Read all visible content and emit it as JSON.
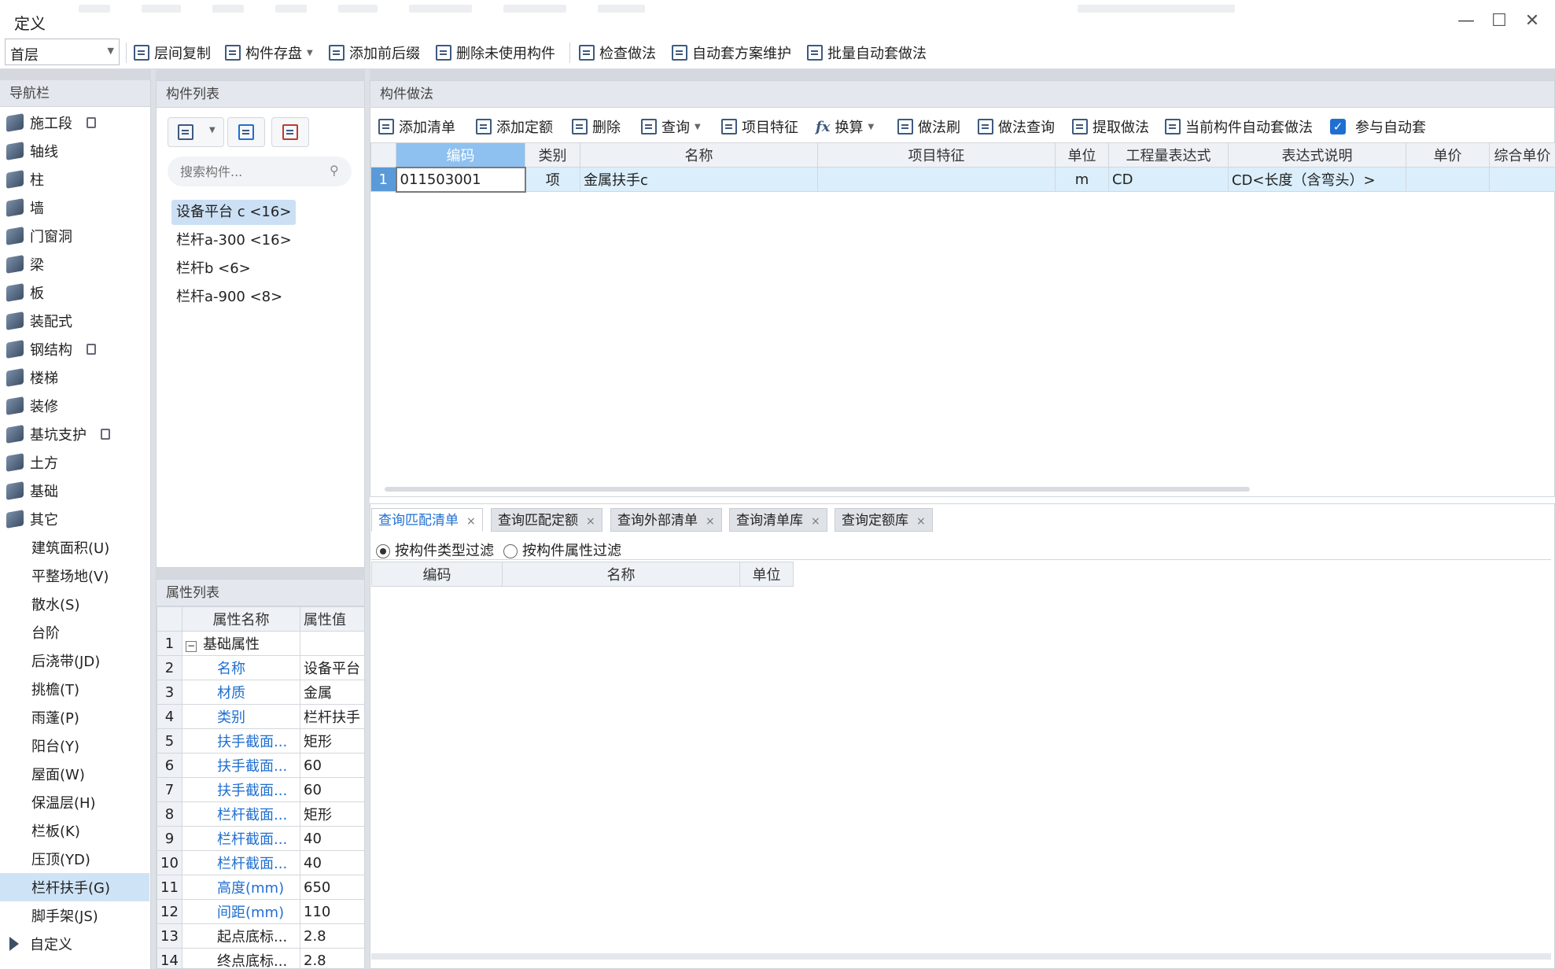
{
  "window": {
    "title": "定义",
    "minimize": "—",
    "maximize": "☐",
    "close": "✕"
  },
  "toolbar": {
    "floor": "首层",
    "items": [
      "层间复制",
      "构件存盘",
      "添加前后缀",
      "删除未使用构件",
      "检查做法",
      "自动套方案维护",
      "批量自动套做法"
    ]
  },
  "nav": {
    "header": "导航栏",
    "items": [
      {
        "label": "施工段",
        "locked": true
      },
      {
        "label": "轴线"
      },
      {
        "label": "柱"
      },
      {
        "label": "墙"
      },
      {
        "label": "门窗洞"
      },
      {
        "label": "梁"
      },
      {
        "label": "板"
      },
      {
        "label": "装配式"
      },
      {
        "label": "钢结构",
        "locked": true
      },
      {
        "label": "楼梯"
      },
      {
        "label": "装修"
      },
      {
        "label": "基坑支护",
        "locked": true
      },
      {
        "label": "土方"
      },
      {
        "label": "基础"
      },
      {
        "label": "其它"
      }
    ],
    "subitems": [
      "建筑面积(U)",
      "平整场地(V)",
      "散水(S)",
      "台阶",
      "后浇带(JD)",
      "挑檐(T)",
      "雨蓬(P)",
      "阳台(Y)",
      "屋面(W)",
      "保温层(H)",
      "栏板(K)",
      "压顶(YD)",
      "栏杆扶手(G)",
      "脚手架(JS)"
    ],
    "selected_sub": "栏杆扶手(G)",
    "custom": "自定义"
  },
  "components": {
    "header": "构件列表",
    "search_placeholder": "搜索构件...",
    "items": [
      "设备平台 c <16>",
      "栏杆a-300 <16>",
      "栏杆b <6>",
      "栏杆a-900 <8>"
    ],
    "selected": "设备平台 c <16>"
  },
  "properties": {
    "header": "属性列表",
    "columns": [
      "属性名称",
      "属性值"
    ],
    "group": "基础属性",
    "rows": [
      {
        "n": "2",
        "name": "名称",
        "value": "设备平台"
      },
      {
        "n": "3",
        "name": "材质",
        "value": "金属"
      },
      {
        "n": "4",
        "name": "类别",
        "value": "栏杆扶手"
      },
      {
        "n": "5",
        "name": "扶手截面...",
        "value": "矩形"
      },
      {
        "n": "6",
        "name": "扶手截面...",
        "value": "60"
      },
      {
        "n": "7",
        "name": "扶手截面...",
        "value": "60"
      },
      {
        "n": "8",
        "name": "栏杆截面...",
        "value": "矩形"
      },
      {
        "n": "9",
        "name": "栏杆截面...",
        "value": "40"
      },
      {
        "n": "10",
        "name": "栏杆截面...",
        "value": "40"
      },
      {
        "n": "11",
        "name": "高度(mm)",
        "value": "650"
      },
      {
        "n": "12",
        "name": "间距(mm)",
        "value": "110"
      },
      {
        "n": "13",
        "name": "起点底标...",
        "value": "2.8"
      },
      {
        "n": "14",
        "name": "终点底标...",
        "value": "2.8"
      }
    ]
  },
  "methods": {
    "header": "构件做法",
    "tools": [
      "添加清单",
      "添加定额",
      "删除",
      "查询",
      "项目特征",
      "换算",
      "做法刷",
      "做法查询",
      "提取做法",
      "当前构件自动套做法",
      "参与自动套"
    ],
    "columns": [
      "编码",
      "类别",
      "名称",
      "项目特征",
      "单位",
      "工程量表达式",
      "表达式说明",
      "单价",
      "综合单价"
    ],
    "rows": [
      {
        "n": "1",
        "code": "011503001",
        "type": "项",
        "name": "金属扶手c",
        "feature": "",
        "unit": "m",
        "expr": "CD",
        "desc": "CD<长度（含弯头）>",
        "price": "",
        "total": ""
      }
    ]
  },
  "query": {
    "tabs": [
      "查询匹配清单",
      "查询匹配定额",
      "查询外部清单",
      "查询清单库",
      "查询定额库"
    ],
    "filters": [
      "按构件类型过滤",
      "按构件属性过滤"
    ],
    "columns": [
      "编码",
      "名称",
      "单位"
    ]
  }
}
